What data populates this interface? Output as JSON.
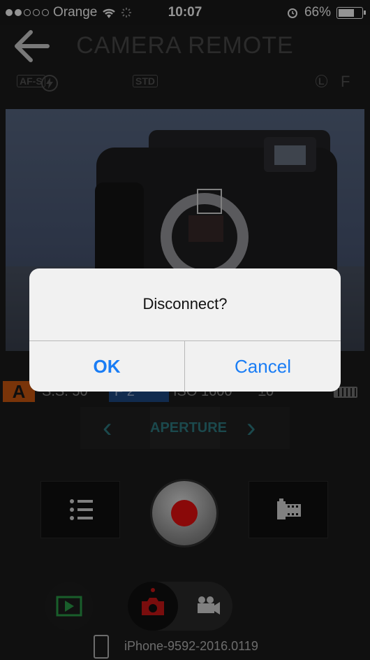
{
  "status_bar": {
    "carrier": "Orange",
    "time": "10:07",
    "battery": "66%",
    "battery_level": 0.66
  },
  "header": {
    "title": "CAMERA REMOTE"
  },
  "icon_row": {
    "af_mode": "AF-S",
    "dynamic_range": "STD",
    "image_size": "L",
    "quality": "F"
  },
  "exposure": {
    "mode": "A",
    "shutter_speed": "S.S. 50",
    "f_number": "F 2",
    "iso": "ISO 1600",
    "ev": "±0"
  },
  "aperture": {
    "label": "APERTURE",
    "prev": "‹",
    "next": "›"
  },
  "device": {
    "name": "iPhone-9592-2016.0119"
  },
  "dialog": {
    "message": "Disconnect?",
    "ok_label": "OK",
    "cancel_label": "Cancel"
  },
  "colors": {
    "mode_badge": "#d15b10",
    "aperture_accent": "#2f7f86",
    "shutter_red": "#e11111",
    "dialog_button": "#1a7df5"
  }
}
